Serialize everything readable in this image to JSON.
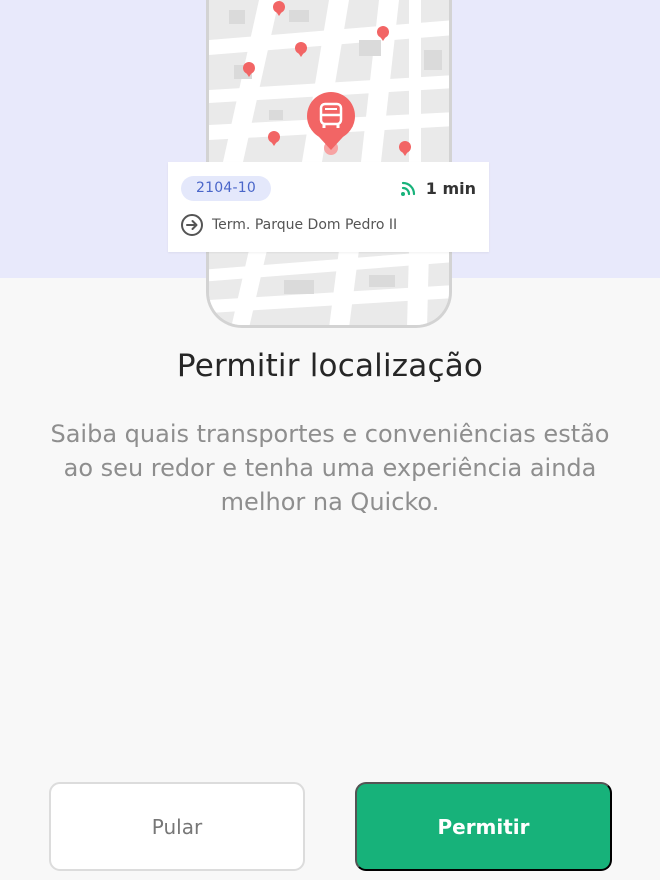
{
  "colors": {
    "hero_background": "#e8e9fb",
    "accent_green": "#17b27a",
    "pin_red": "#f26565",
    "route_badge_bg": "#e4e8fb",
    "route_badge_text": "#4a66c9"
  },
  "illustration": {
    "bus_icon": "bus-icon",
    "card": {
      "route": "2104-10",
      "eta": "1 min",
      "eta_icon": "signal-waves-icon",
      "destination": "Term. Parque Dom Pedro II",
      "destination_icon": "arrow-circle-right-icon"
    }
  },
  "title": "Permitir localização",
  "description": "Saiba quais transportes e conveniências estão ao seu redor e tenha uma experiência ainda melhor na Quicko.",
  "buttons": {
    "skip": "Pular",
    "allow": "Permitir"
  }
}
